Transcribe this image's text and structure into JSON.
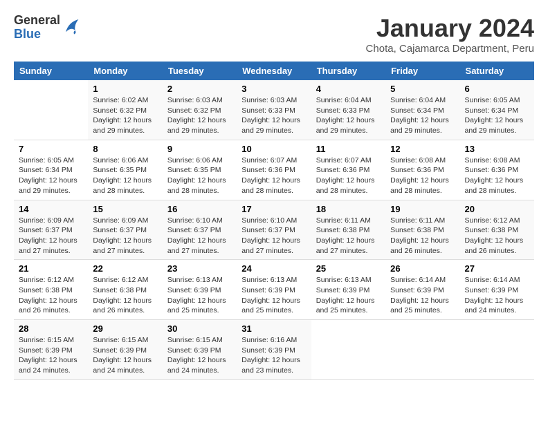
{
  "header": {
    "logo_general": "General",
    "logo_blue": "Blue",
    "title": "January 2024",
    "subtitle": "Chota, Cajamarca Department, Peru"
  },
  "weekdays": [
    "Sunday",
    "Monday",
    "Tuesday",
    "Wednesday",
    "Thursday",
    "Friday",
    "Saturday"
  ],
  "weeks": [
    [
      {
        "day": "",
        "info": ""
      },
      {
        "day": "1",
        "info": "Sunrise: 6:02 AM\nSunset: 6:32 PM\nDaylight: 12 hours\nand 29 minutes."
      },
      {
        "day": "2",
        "info": "Sunrise: 6:03 AM\nSunset: 6:32 PM\nDaylight: 12 hours\nand 29 minutes."
      },
      {
        "day": "3",
        "info": "Sunrise: 6:03 AM\nSunset: 6:33 PM\nDaylight: 12 hours\nand 29 minutes."
      },
      {
        "day": "4",
        "info": "Sunrise: 6:04 AM\nSunset: 6:33 PM\nDaylight: 12 hours\nand 29 minutes."
      },
      {
        "day": "5",
        "info": "Sunrise: 6:04 AM\nSunset: 6:34 PM\nDaylight: 12 hours\nand 29 minutes."
      },
      {
        "day": "6",
        "info": "Sunrise: 6:05 AM\nSunset: 6:34 PM\nDaylight: 12 hours\nand 29 minutes."
      }
    ],
    [
      {
        "day": "7",
        "info": "Sunrise: 6:05 AM\nSunset: 6:34 PM\nDaylight: 12 hours\nand 29 minutes."
      },
      {
        "day": "8",
        "info": "Sunrise: 6:06 AM\nSunset: 6:35 PM\nDaylight: 12 hours\nand 28 minutes."
      },
      {
        "day": "9",
        "info": "Sunrise: 6:06 AM\nSunset: 6:35 PM\nDaylight: 12 hours\nand 28 minutes."
      },
      {
        "day": "10",
        "info": "Sunrise: 6:07 AM\nSunset: 6:36 PM\nDaylight: 12 hours\nand 28 minutes."
      },
      {
        "day": "11",
        "info": "Sunrise: 6:07 AM\nSunset: 6:36 PM\nDaylight: 12 hours\nand 28 minutes."
      },
      {
        "day": "12",
        "info": "Sunrise: 6:08 AM\nSunset: 6:36 PM\nDaylight: 12 hours\nand 28 minutes."
      },
      {
        "day": "13",
        "info": "Sunrise: 6:08 AM\nSunset: 6:36 PM\nDaylight: 12 hours\nand 28 minutes."
      }
    ],
    [
      {
        "day": "14",
        "info": "Sunrise: 6:09 AM\nSunset: 6:37 PM\nDaylight: 12 hours\nand 27 minutes."
      },
      {
        "day": "15",
        "info": "Sunrise: 6:09 AM\nSunset: 6:37 PM\nDaylight: 12 hours\nand 27 minutes."
      },
      {
        "day": "16",
        "info": "Sunrise: 6:10 AM\nSunset: 6:37 PM\nDaylight: 12 hours\nand 27 minutes."
      },
      {
        "day": "17",
        "info": "Sunrise: 6:10 AM\nSunset: 6:37 PM\nDaylight: 12 hours\nand 27 minutes."
      },
      {
        "day": "18",
        "info": "Sunrise: 6:11 AM\nSunset: 6:38 PM\nDaylight: 12 hours\nand 27 minutes."
      },
      {
        "day": "19",
        "info": "Sunrise: 6:11 AM\nSunset: 6:38 PM\nDaylight: 12 hours\nand 26 minutes."
      },
      {
        "day": "20",
        "info": "Sunrise: 6:12 AM\nSunset: 6:38 PM\nDaylight: 12 hours\nand 26 minutes."
      }
    ],
    [
      {
        "day": "21",
        "info": "Sunrise: 6:12 AM\nSunset: 6:38 PM\nDaylight: 12 hours\nand 26 minutes."
      },
      {
        "day": "22",
        "info": "Sunrise: 6:12 AM\nSunset: 6:38 PM\nDaylight: 12 hours\nand 26 minutes."
      },
      {
        "day": "23",
        "info": "Sunrise: 6:13 AM\nSunset: 6:39 PM\nDaylight: 12 hours\nand 25 minutes."
      },
      {
        "day": "24",
        "info": "Sunrise: 6:13 AM\nSunset: 6:39 PM\nDaylight: 12 hours\nand 25 minutes."
      },
      {
        "day": "25",
        "info": "Sunrise: 6:13 AM\nSunset: 6:39 PM\nDaylight: 12 hours\nand 25 minutes."
      },
      {
        "day": "26",
        "info": "Sunrise: 6:14 AM\nSunset: 6:39 PM\nDaylight: 12 hours\nand 25 minutes."
      },
      {
        "day": "27",
        "info": "Sunrise: 6:14 AM\nSunset: 6:39 PM\nDaylight: 12 hours\nand 24 minutes."
      }
    ],
    [
      {
        "day": "28",
        "info": "Sunrise: 6:15 AM\nSunset: 6:39 PM\nDaylight: 12 hours\nand 24 minutes."
      },
      {
        "day": "29",
        "info": "Sunrise: 6:15 AM\nSunset: 6:39 PM\nDaylight: 12 hours\nand 24 minutes."
      },
      {
        "day": "30",
        "info": "Sunrise: 6:15 AM\nSunset: 6:39 PM\nDaylight: 12 hours\nand 24 minutes."
      },
      {
        "day": "31",
        "info": "Sunrise: 6:16 AM\nSunset: 6:39 PM\nDaylight: 12 hours\nand 23 minutes."
      },
      {
        "day": "",
        "info": ""
      },
      {
        "day": "",
        "info": ""
      },
      {
        "day": "",
        "info": ""
      }
    ]
  ]
}
